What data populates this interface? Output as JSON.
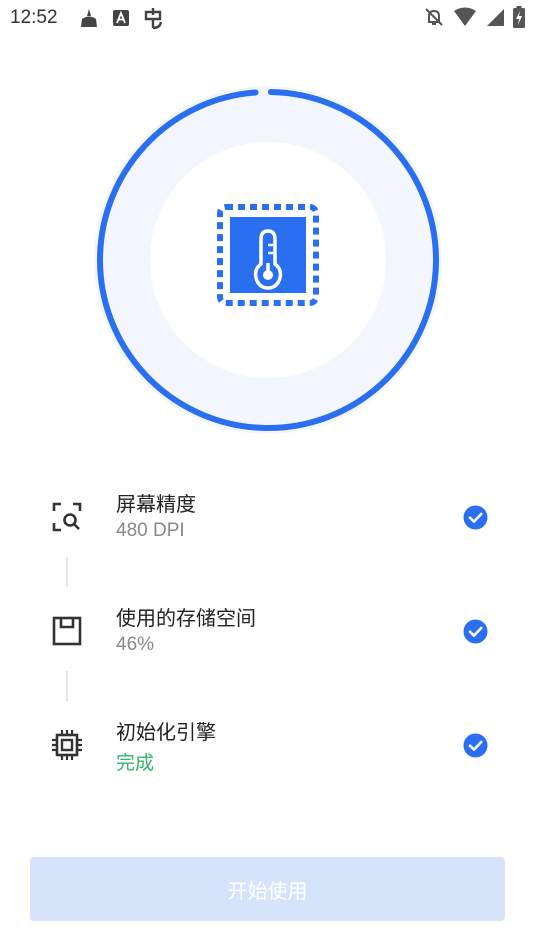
{
  "status_bar": {
    "time": "12:52",
    "left_icons": [
      "cleaner-broom-icon",
      "font-a-icon",
      "bug-icon"
    ],
    "right_icons": [
      "notifications-off-icon",
      "wifi-icon",
      "signal-icon",
      "battery-charging-icon"
    ]
  },
  "hero": {
    "icon": "thermometer-chip-icon",
    "progress": 0.985,
    "accent_color": "#2a6ff0",
    "track_color": "#f3f6fd"
  },
  "steps": [
    {
      "icon": "screen-scan-icon",
      "title": "屏幕精度",
      "subtitle": "480 DPI",
      "status": "complete"
    },
    {
      "icon": "storage-disk-icon",
      "title": "使用的存储空间",
      "subtitle": "46%",
      "status": "complete"
    },
    {
      "icon": "cpu-chip-icon",
      "title": "初始化引擎",
      "subtitle": "完成",
      "status": "complete"
    }
  ],
  "colors": {
    "done_text": "#2fb56a",
    "check_bg": "#2a6ff0",
    "button_bg": "#d5e3fb"
  },
  "start_button": {
    "label": "开始使用",
    "enabled": false
  }
}
